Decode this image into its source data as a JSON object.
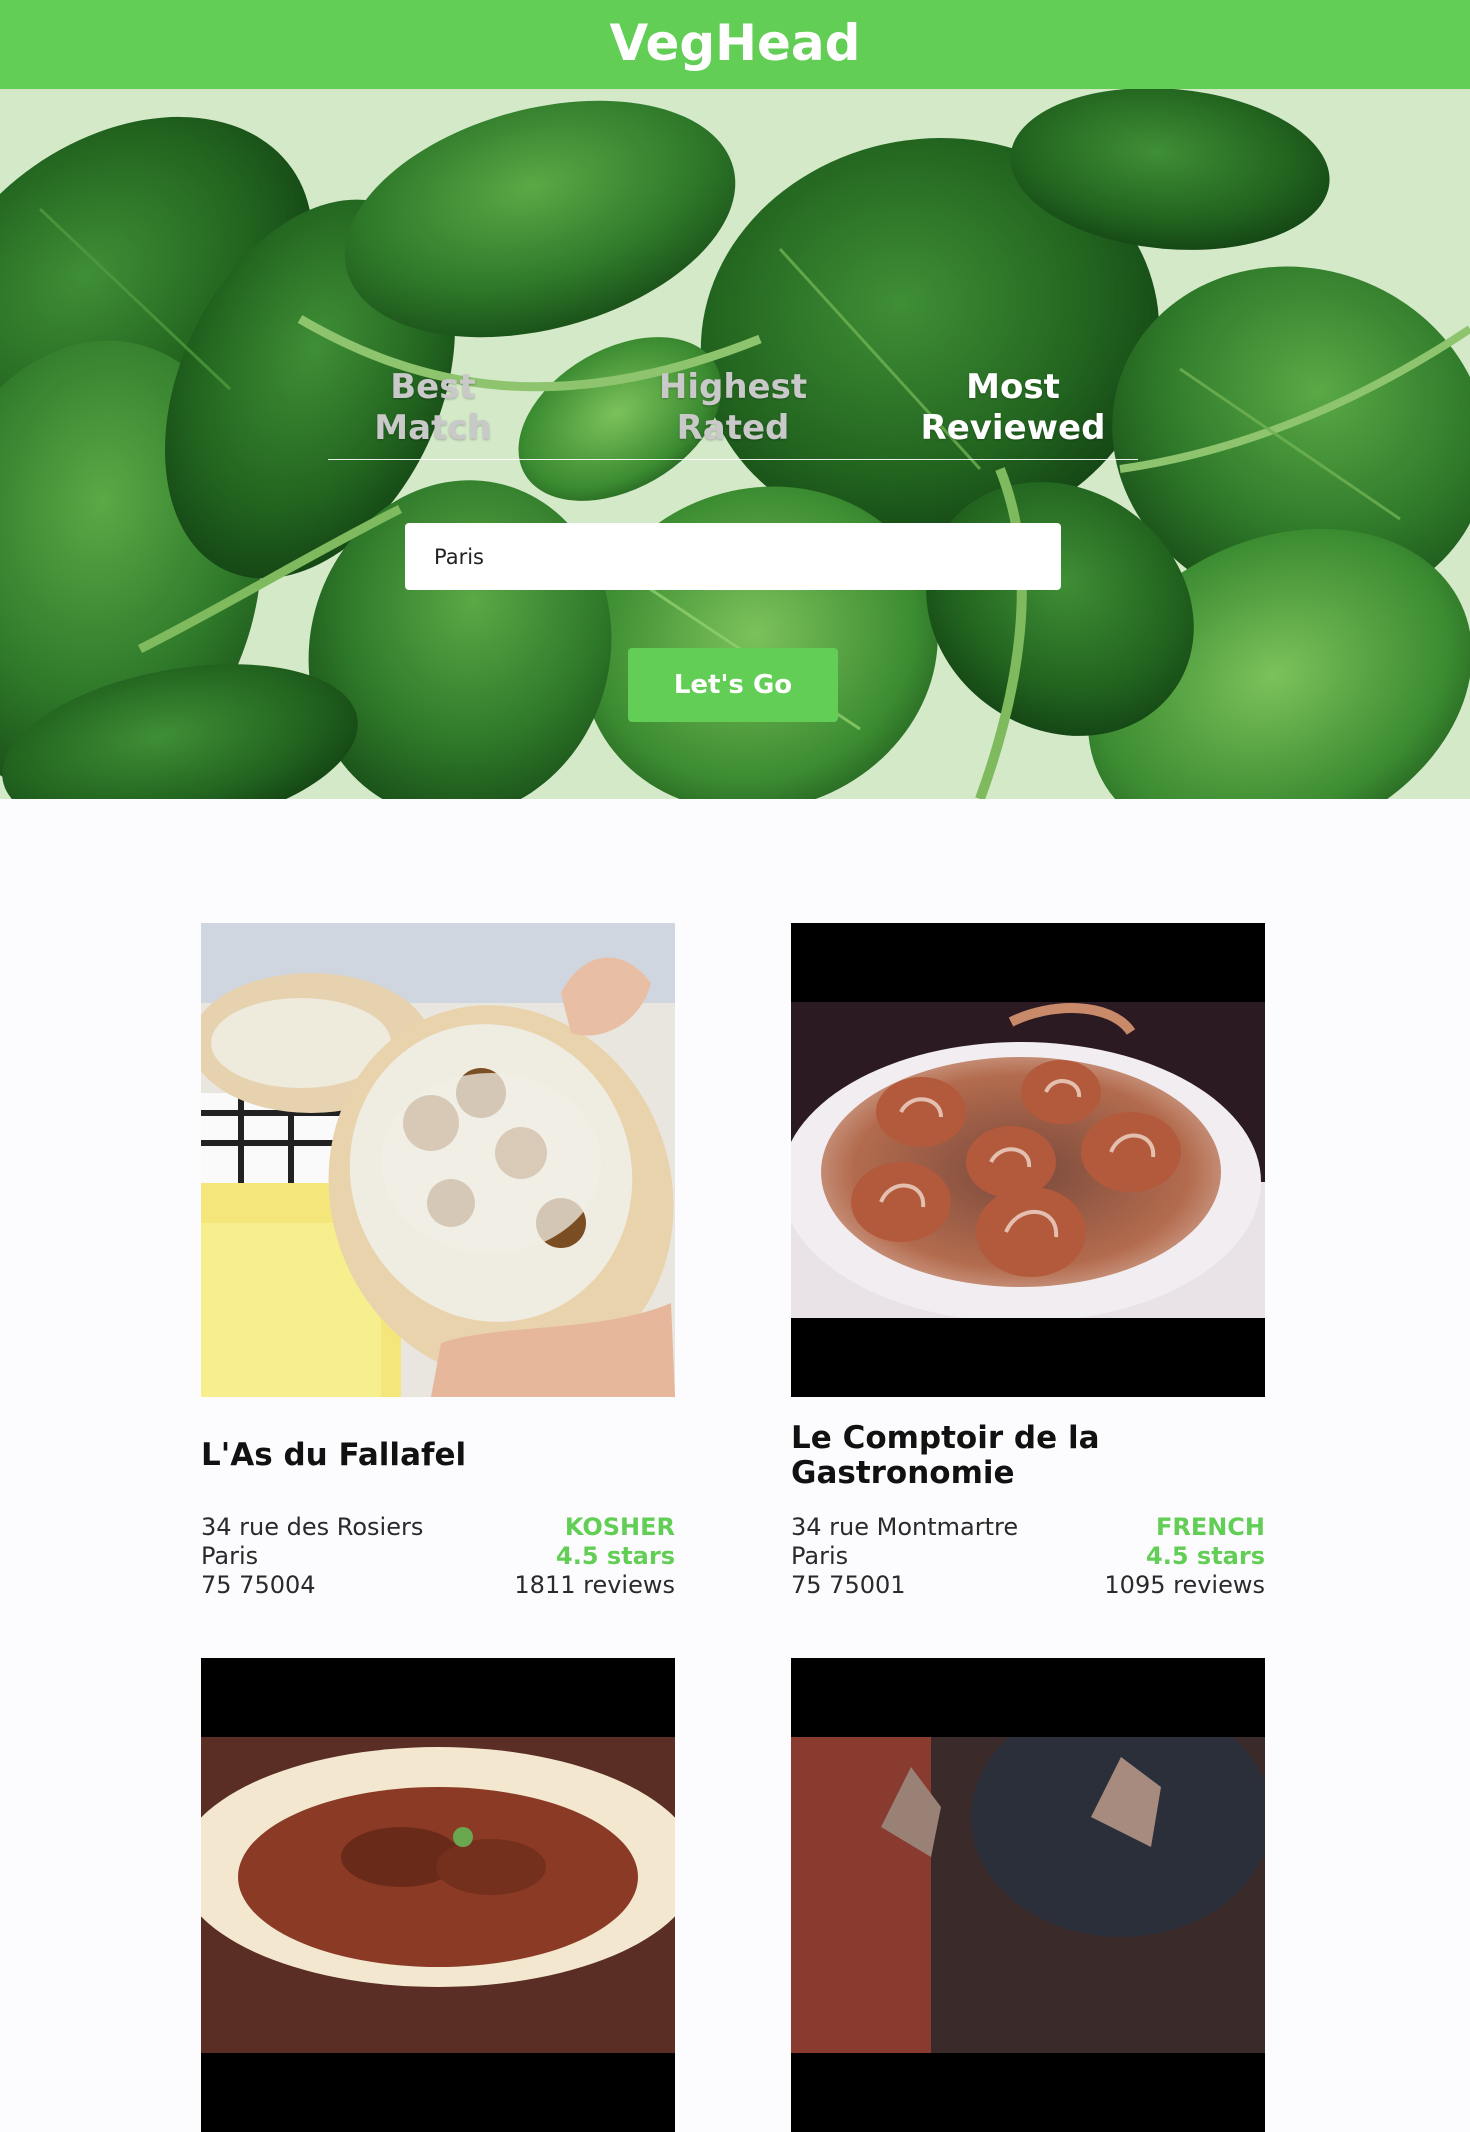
{
  "header": {
    "brand": "VegHead"
  },
  "search": {
    "tabs": [
      {
        "lines": [
          "Best",
          "Match"
        ],
        "active": false
      },
      {
        "lines": [
          "Highest",
          "Rated"
        ],
        "active": false
      },
      {
        "lines": [
          "Most",
          "Reviewed"
        ],
        "active": true
      }
    ],
    "location_value": "Paris",
    "submit_label": "Let's Go"
  },
  "results": [
    {
      "name": "L'As du Fallafel",
      "address": [
        "34 rue des Rosiers",
        "Paris",
        "75 75004"
      ],
      "cuisine": "KOSHER",
      "rating": "4.5 stars",
      "reviews": "1811 reviews"
    },
    {
      "name": "Le Comptoir de la Gastronomie",
      "address": [
        "34 rue Montmartre",
        "Paris",
        "75 75001"
      ],
      "cuisine": "FRENCH",
      "rating": "4.5 stars",
      "reviews": "1095 reviews"
    },
    {
      "name": "",
      "address": [],
      "cuisine": "",
      "rating": "",
      "reviews": ""
    },
    {
      "name": "",
      "address": [],
      "cuisine": "",
      "rating": "",
      "reviews": ""
    }
  ],
  "colors": {
    "brand_green": "#63ce55",
    "text_dark": "#111111",
    "tab_inactive": "#c9c9c9"
  }
}
